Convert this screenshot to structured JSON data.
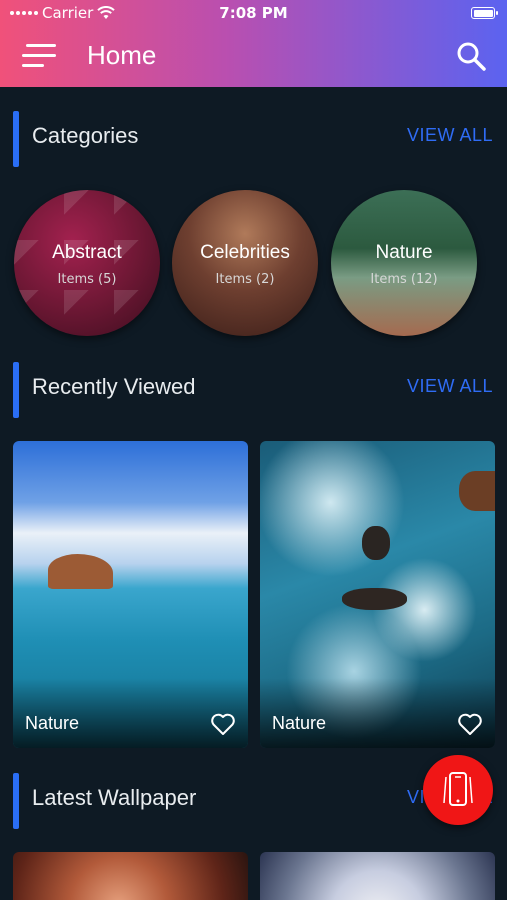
{
  "status_bar": {
    "carrier": "Carrier",
    "time": "7:08 PM"
  },
  "header": {
    "title": "Home"
  },
  "categories": {
    "label": "Categories",
    "view_all": "VIEW ALL",
    "items": [
      {
        "name": "Abstract",
        "count": "Items (5)"
      },
      {
        "name": "Celebrities",
        "count": "Items (2)"
      },
      {
        "name": "Nature",
        "count": "Items (12)"
      }
    ]
  },
  "recently_viewed": {
    "label": "Recently Viewed",
    "view_all": "VIEW ALL",
    "items": [
      {
        "name": "Nature"
      },
      {
        "name": "Nature"
      }
    ]
  },
  "latest_wallpaper": {
    "label": "Latest Wallpaper",
    "view_all": "VIEW ALL"
  },
  "colors": {
    "accent": "#2f6cf5",
    "background": "#0e1a24",
    "fab": "#f01616"
  },
  "icons": [
    "menu-icon",
    "search-icon",
    "heart-icon",
    "phone-rotate-icon",
    "wifi-icon"
  ]
}
